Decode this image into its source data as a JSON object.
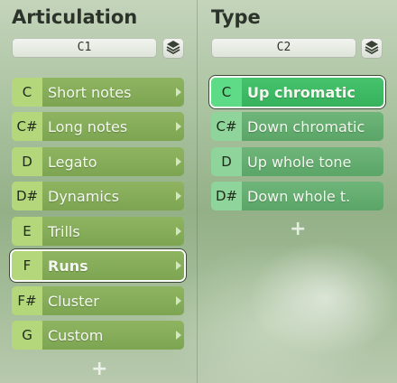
{
  "articulation": {
    "title": "Articulation",
    "dropdown": "C1",
    "add": "+",
    "items": [
      {
        "key": "C",
        "label": "Short notes"
      },
      {
        "key": "C#",
        "label": "Long notes"
      },
      {
        "key": "D",
        "label": "Legato"
      },
      {
        "key": "D#",
        "label": "Dynamics"
      },
      {
        "key": "E",
        "label": "Trills"
      },
      {
        "key": "F",
        "label": "Runs",
        "selected": true
      },
      {
        "key": "F#",
        "label": "Cluster"
      },
      {
        "key": "G",
        "label": "Custom"
      }
    ]
  },
  "type": {
    "title": "Type",
    "dropdown": "C2",
    "add": "+",
    "items": [
      {
        "key": "C",
        "label": "Up chromatic",
        "selected": true
      },
      {
        "key": "C#",
        "label": "Down chromatic"
      },
      {
        "key": "D",
        "label": "Up whole tone"
      },
      {
        "key": "D#",
        "label": "Down whole t."
      }
    ]
  },
  "icons": {
    "layers": "layers-icon",
    "arrow": "chevron-right-icon",
    "add": "plus-icon"
  }
}
